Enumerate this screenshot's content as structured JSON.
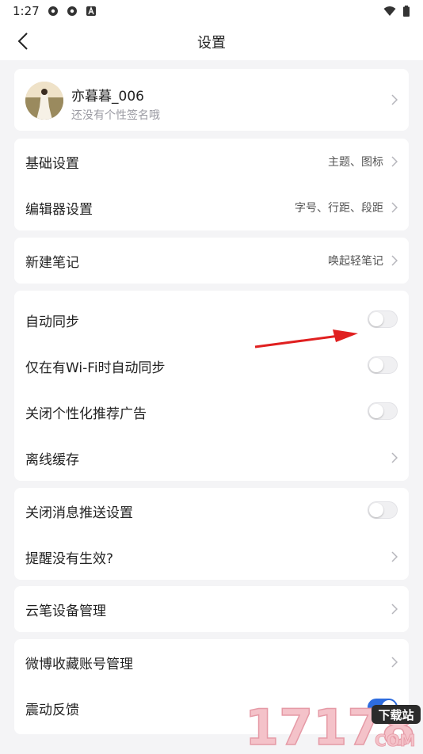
{
  "status_bar": {
    "time": "1:27",
    "icons": [
      "settings-icon",
      "settings-icon",
      "font-icon",
      "wifi-icon",
      "battery-icon"
    ]
  },
  "header": {
    "title": "设置",
    "back_icon": "chevron-left-icon"
  },
  "profile": {
    "name": "亦暮暮_006",
    "signature": "还没有个性签名哦"
  },
  "settings_groups": [
    {
      "rows": [
        {
          "label": "基础设置",
          "value": "主题、图标",
          "control": "chevron"
        },
        {
          "label": "编辑器设置",
          "value": "字号、行距、段距",
          "control": "chevron"
        }
      ]
    },
    {
      "rows": [
        {
          "label": "新建笔记",
          "value": "唤起轻笔记",
          "control": "chevron"
        }
      ]
    },
    {
      "rows": [
        {
          "label": "自动同步",
          "control": "toggle",
          "on": false
        },
        {
          "label": "仅在有Wi-Fi时自动同步",
          "control": "toggle",
          "on": false
        },
        {
          "label": "关闭个性化推荐广告",
          "control": "toggle",
          "on": false
        },
        {
          "label": "离线缓存",
          "control": "chevron"
        }
      ]
    },
    {
      "rows": [
        {
          "label": "关闭消息推送设置",
          "control": "toggle",
          "on": false
        },
        {
          "label": "提醒没有生效?",
          "control": "chevron"
        }
      ]
    },
    {
      "rows": [
        {
          "label": "云笔设备管理",
          "control": "chevron"
        }
      ]
    },
    {
      "rows": [
        {
          "label": "微博收藏账号管理",
          "control": "chevron"
        },
        {
          "label": "震动反馈",
          "control": "toggle",
          "on": true
        }
      ]
    }
  ],
  "watermark": {
    "number": "17178",
    "domain": "COM",
    "tag": "下载站"
  },
  "colors": {
    "accent": "#2d6cdf",
    "annotation_arrow": "#e02020"
  }
}
